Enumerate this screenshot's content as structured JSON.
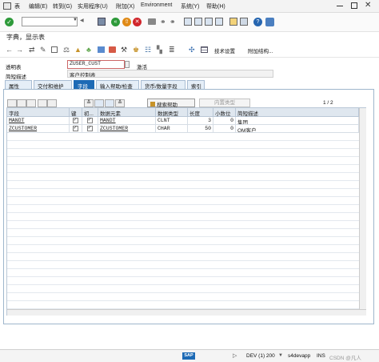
{
  "menubar": {
    "items": [
      "表",
      "编辑(E)",
      "转到(G)",
      "实用程序(U)",
      "附加(X)",
      "Environment",
      "系统(Y)",
      "帮助(H)"
    ],
    "window_controls": [
      "minimize",
      "restore",
      "close"
    ]
  },
  "toolbar1": {
    "command_field_value": "",
    "icons": [
      "enter-icon",
      "save-icon",
      "back-icon",
      "exit-icon",
      "cancel-icon",
      "print-icon",
      "find-icon",
      "find-next-icon",
      "first-page-icon",
      "prev-page-icon",
      "next-page-icon",
      "last-page-icon",
      "new-session-icon",
      "shortcut-icon",
      "help-icon",
      "customize-icon"
    ]
  },
  "title": "字典，显示表",
  "toolbar2": {
    "tech_settings_label": "技术设置",
    "append_structure_label": "附加结构..."
  },
  "header": {
    "table_label": "透明表",
    "table_value": "ZUSER_CUST",
    "table_status": "激活",
    "desc_label": "简短描述",
    "desc_value": "客户控制表"
  },
  "tabs": [
    "属性",
    "交付和维护",
    "字段",
    "输入帮助/检查",
    "货币/数量字段",
    "索引"
  ],
  "active_tab": 2,
  "grid_toolbar": {
    "search_help_label": "搜索帮助",
    "builtin_type_label": "内置类型",
    "page_indicator": "1 / 2"
  },
  "grid": {
    "columns": [
      "字段",
      "键",
      "初...",
      "数据元素",
      "数据类型",
      "长度",
      "小数位",
      "简短描述"
    ],
    "rows": [
      {
        "field": "MANDT",
        "key": true,
        "init": true,
        "data_element": "MANDT",
        "data_type": "CLNT",
        "length": "3",
        "decimals": "0",
        "description": "集团"
      },
      {
        "field": "ZCUSTOMER",
        "key": true,
        "init": true,
        "data_element": "ZCUSTOMER",
        "data_type": "CHAR",
        "length": "50",
        "decimals": "0",
        "description": "QM客户"
      }
    ]
  },
  "statusbar": {
    "system": "DEV (1) 200",
    "server": "s4devapp",
    "mode": "INS",
    "watermark": "CSDN @凡人"
  }
}
